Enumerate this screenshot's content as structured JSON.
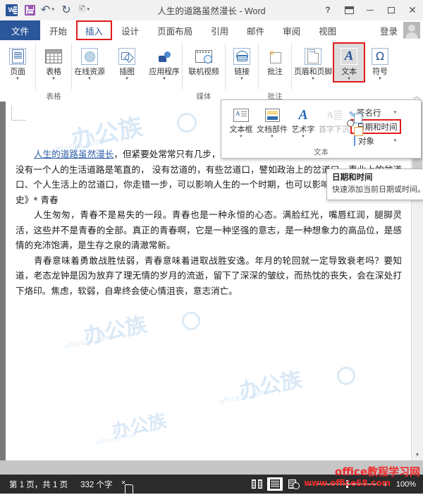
{
  "titlebar": {
    "document_title": "人生的道路虽然漫长 - Word",
    "quick_access": [
      {
        "name": "word-logo",
        "label": "W"
      },
      {
        "name": "save-icon",
        "label": "保存"
      },
      {
        "name": "undo-icon",
        "label": "撤消"
      },
      {
        "name": "redo-icon",
        "label": "恢复"
      },
      {
        "name": "touch-mode-icon",
        "label": "触摸/鼠标模式"
      }
    ],
    "window_controls": [
      {
        "name": "help-button",
        "label": "?"
      },
      {
        "name": "ribbon-display-options-button",
        "label": "功能区显示选项"
      },
      {
        "name": "minimize-button",
        "label": "最小化"
      },
      {
        "name": "maximize-button",
        "label": "最大化"
      },
      {
        "name": "close-button",
        "label": "✕"
      }
    ]
  },
  "tabs": [
    {
      "id": "file",
      "label": "文件"
    },
    {
      "id": "home",
      "label": "开始"
    },
    {
      "id": "insert",
      "label": "插入"
    },
    {
      "id": "design",
      "label": "设计"
    },
    {
      "id": "layout",
      "label": "页面布局"
    },
    {
      "id": "references",
      "label": "引用"
    },
    {
      "id": "mailings",
      "label": "邮件"
    },
    {
      "id": "review",
      "label": "审阅"
    },
    {
      "id": "view",
      "label": "视图"
    }
  ],
  "active_tab": "插入",
  "signin": {
    "label": "登录"
  },
  "ribbon": {
    "groups": [
      {
        "label": "",
        "buttons": [
          {
            "id": "pages",
            "label": "页面",
            "icon": "page-icon",
            "dropdown": true
          }
        ]
      },
      {
        "label": "表格",
        "buttons": [
          {
            "id": "table",
            "label": "表格",
            "icon": "table-icon",
            "dropdown": true
          }
        ]
      },
      {
        "label": "",
        "buttons": [
          {
            "id": "online-resource",
            "label": "在线资源",
            "icon": "online-resource-icon",
            "dropdown": true
          },
          {
            "id": "illustrations",
            "label": "插图",
            "icon": "illustrations-icon",
            "dropdown": true
          },
          {
            "id": "apps",
            "label": "应用程序",
            "icon": "apps-icon",
            "dropdown": true
          }
        ]
      },
      {
        "label": "媒体",
        "buttons": [
          {
            "id": "online-video",
            "label": "联机视频",
            "icon": "online-video-icon",
            "dropdown": false
          }
        ]
      },
      {
        "label": "",
        "buttons": [
          {
            "id": "links",
            "label": "链接",
            "icon": "link-icon",
            "dropdown": true
          }
        ]
      },
      {
        "label": "批注",
        "buttons": [
          {
            "id": "comment",
            "label": "批注",
            "icon": "comment-icon",
            "dropdown": false
          }
        ]
      },
      {
        "label": "",
        "buttons": [
          {
            "id": "header-footer",
            "label": "页眉和页脚",
            "icon": "header-footer-icon",
            "dropdown": true
          },
          {
            "id": "text",
            "label": "文本",
            "icon": "text-A-icon",
            "dropdown": true,
            "highlighted": true
          },
          {
            "id": "symbols",
            "label": "符号",
            "icon": "omega-icon",
            "dropdown": true
          }
        ]
      }
    ],
    "collapse_label": "︿"
  },
  "text_gallery": {
    "group_label": "文本",
    "big_buttons": [
      {
        "id": "text-box",
        "label": "文本框",
        "icon": "text-box-icon",
        "dropdown": true,
        "dimmed": false
      },
      {
        "id": "quick-parts",
        "label": "文档部件",
        "icon": "quick-parts-icon",
        "dropdown": true,
        "dimmed": false
      },
      {
        "id": "word-art",
        "label": "艺术字",
        "icon": "word-art-icon",
        "dropdown": true,
        "dimmed": false
      },
      {
        "id": "drop-cap",
        "label": "首字下沉",
        "icon": "drop-cap-icon",
        "dropdown": false,
        "dimmed": true
      }
    ],
    "small_rows": [
      {
        "id": "signature-line",
        "label": "签名行",
        "icon": "signature-line-icon",
        "dropdown": true,
        "highlighted": false
      },
      {
        "id": "date-time",
        "label": "日期和时间",
        "icon": "date-time-icon",
        "dropdown": false,
        "highlighted": true
      },
      {
        "id": "object",
        "label": "对象",
        "icon": "object-icon",
        "dropdown": true,
        "highlighted": false
      }
    ]
  },
  "tooltip": {
    "title": "日期和时间",
    "body": "快速添加当前日期或时间。"
  },
  "document": {
    "paragraphs": [
      {
        "indent": true,
        "link_text": "人生的道路虽然漫长",
        "text": "，但紧要处常常只有几步，特别是当人年轻的时候。"
      },
      {
        "indent": false,
        "text": "没有一个人的生活道路是笔直的， 没有岔道的，有些岔道口，譬如政治上的岔道口、事业上的岔道口、个人生活上的岔道口，你走错一步，可以影响人生的一个时期，也可以影响一生。摘抄《创业史》* 青春"
      },
      {
        "indent": true,
        "text": "人生匆匆，青春不是易失的一段。青春也是一种永恒的心态。满脸红光，嘴唇红润，腿脚灵活，这些并不是青春的全部。真正的青春啊，它是一种坚强的意志，是一种想象力的高品位，是感情的充沛饱满，是生存之泉的清澈常新。"
      },
      {
        "indent": true,
        "text": "青春意味着勇敢战胜怯弱，青春意味着进取战胜安逸。年月的轮回就一定导致衰老吗？要知道，老态龙钟是因为放弃了理无情的岁月的流逝，留下了深深的皱纹，而热忱的丧失，会在深处打下烙印。焦虑，软弱，自卑终会使心情沮丧，意志消亡。"
      }
    ]
  },
  "watermarks": {
    "doc_main": "办公族",
    "doc_sub": "officezu.com",
    "brand_red_top": "office教程学习网",
    "brand_red_bottom": "www.office68.com"
  },
  "statusbar": {
    "page_info": "第 1 页，共 1 页",
    "word_count": "332 个字",
    "proofing_label": "校对",
    "views": [
      {
        "id": "read-mode",
        "label": "阅读视图",
        "active": false
      },
      {
        "id": "print-layout",
        "label": "页面视图",
        "active": true
      },
      {
        "id": "web-layout",
        "label": "Web 版式视图",
        "active": false
      }
    ],
    "zoom_out": "−",
    "zoom_in": "+",
    "zoom_level": "100%"
  }
}
